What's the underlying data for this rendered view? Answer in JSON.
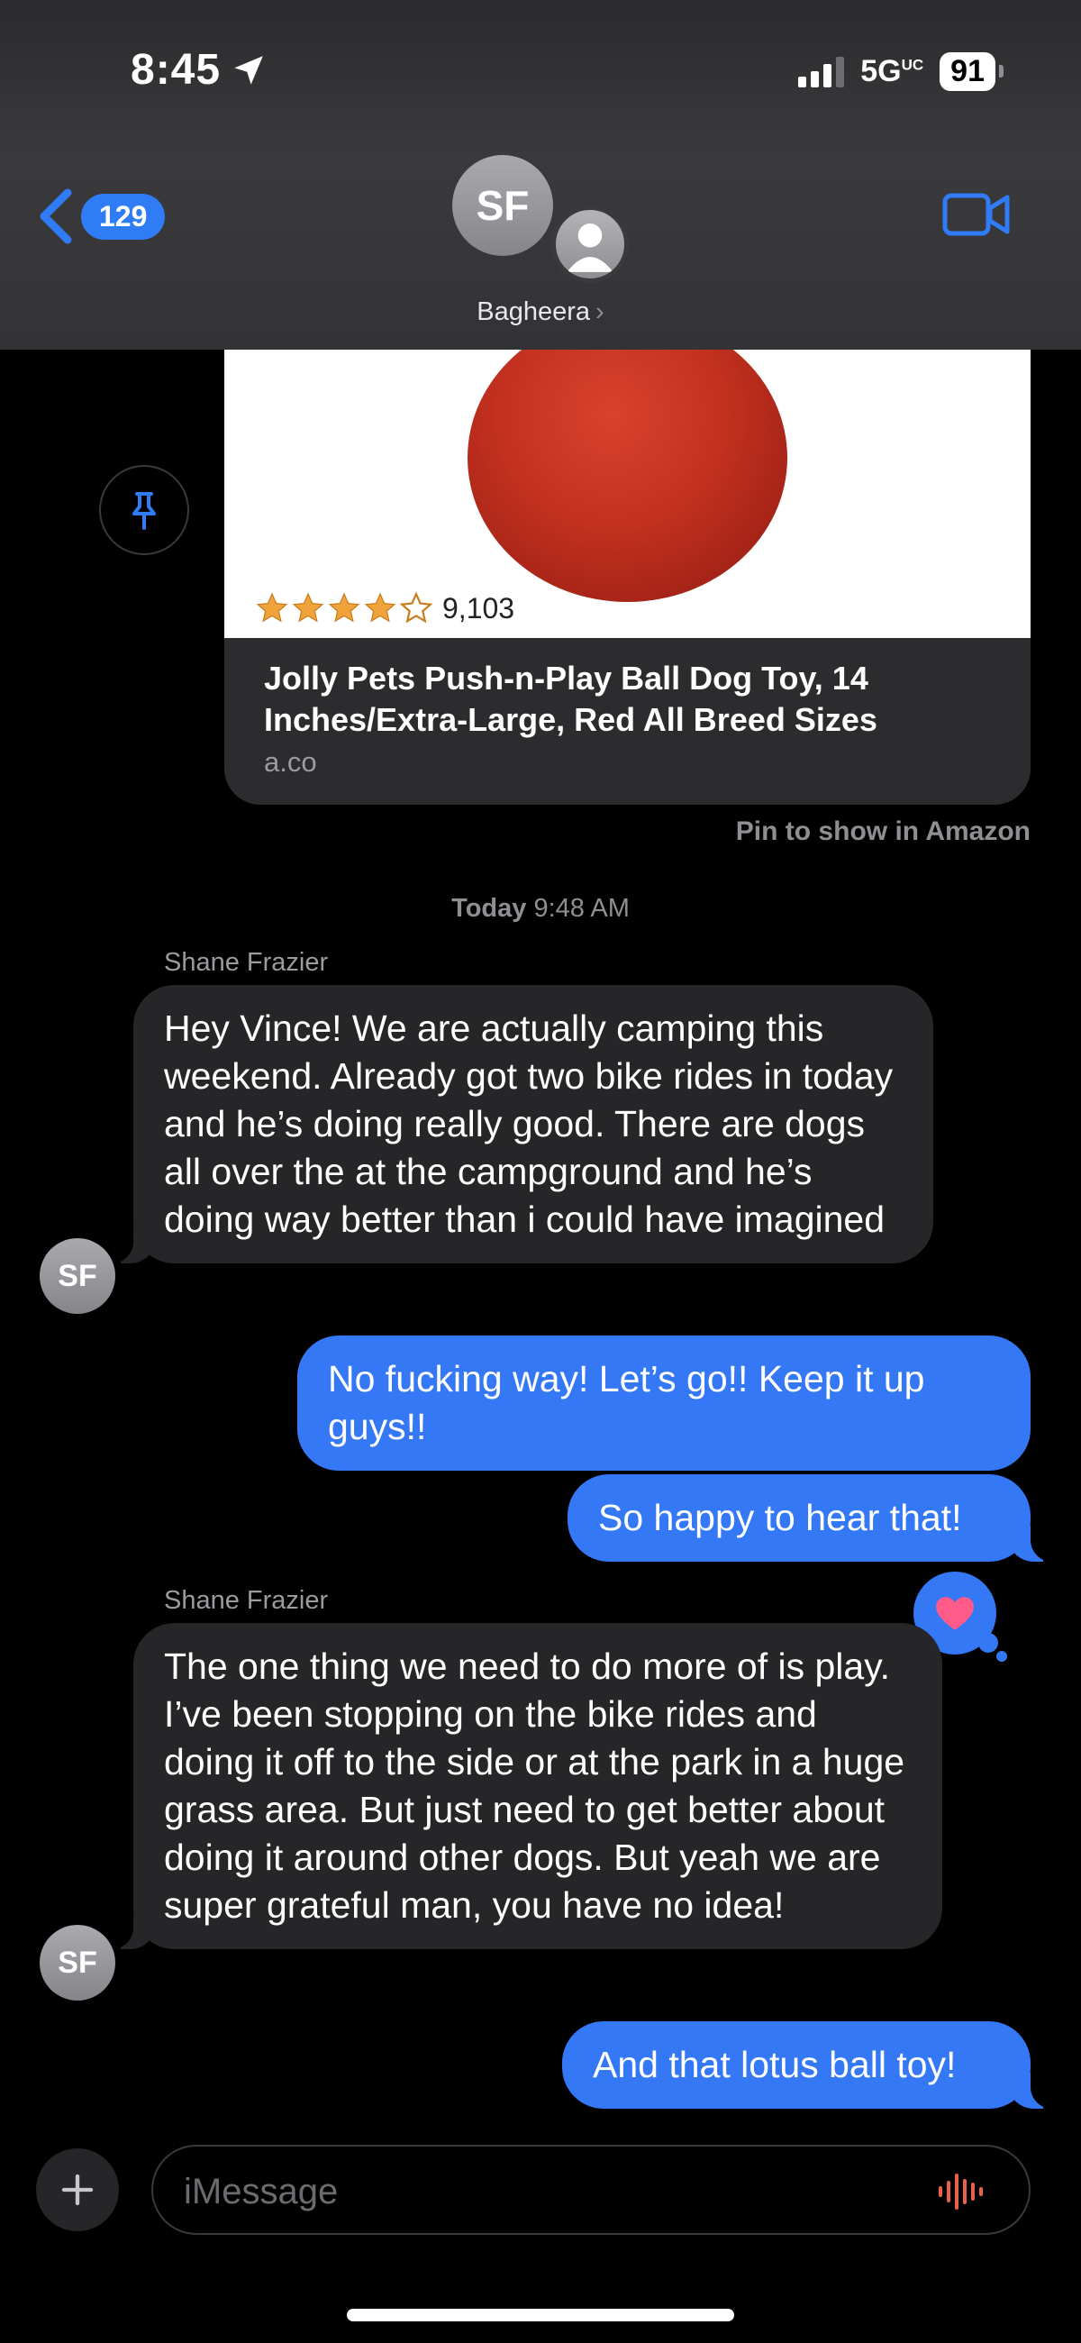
{
  "status": {
    "time": "8:45",
    "network": "5G",
    "network_sup": "UC",
    "battery": "91"
  },
  "header": {
    "back_count": "129",
    "avatar_initials": "SF",
    "contact_name": "Bagheera",
    "contact_chevron": "›"
  },
  "link_preview": {
    "rating_count": "9,103",
    "stars": 4,
    "title": "Jolly Pets Push-n-Play Ball Dog Toy, 14 Inches/Extra-Large, Red All Breed Sizes",
    "url": "a.co",
    "pin_note": "Pin to show in Amazon"
  },
  "timestamp": {
    "day": "Today",
    "time": "9:48 AM"
  },
  "messages": [
    {
      "sender": "Shane Frazier",
      "direction": "in",
      "initials": "SF",
      "text": "Hey Vince! We are actually camping this weekend. Already got two bike rides in today and he’s doing really good. There are dogs all over the at the campground and he’s doing way better than i could have imagined"
    },
    {
      "direction": "out",
      "text": "No fucking way! Let’s go!! Keep it up guys!!"
    },
    {
      "direction": "out",
      "text": "So happy to hear that!",
      "tapback": "heart"
    },
    {
      "sender": "Shane Frazier",
      "direction": "in",
      "initials": "SF",
      "text": "The one thing we need to do more of is play. I’ve been stopping on the bike rides and doing it off to the side or at the park in a huge grass area. But just need to get better about doing it around other dogs. But yeah we are super grateful man, you have no idea!"
    },
    {
      "direction": "out",
      "text": "And that lotus ball toy!"
    }
  ],
  "compose": {
    "placeholder": "iMessage"
  },
  "colors": {
    "accent": "#3478f6",
    "incoming": "#262628",
    "background": "#000000",
    "star": "#f0a33a",
    "tapback_heart": "#ff5a8a"
  },
  "icons": [
    "location-arrow-icon",
    "signal-icon",
    "back-chevron-icon",
    "person-icon",
    "video-camera-icon",
    "pin-icon",
    "star-icon",
    "heart-icon",
    "plus-icon",
    "waveform-icon"
  ]
}
